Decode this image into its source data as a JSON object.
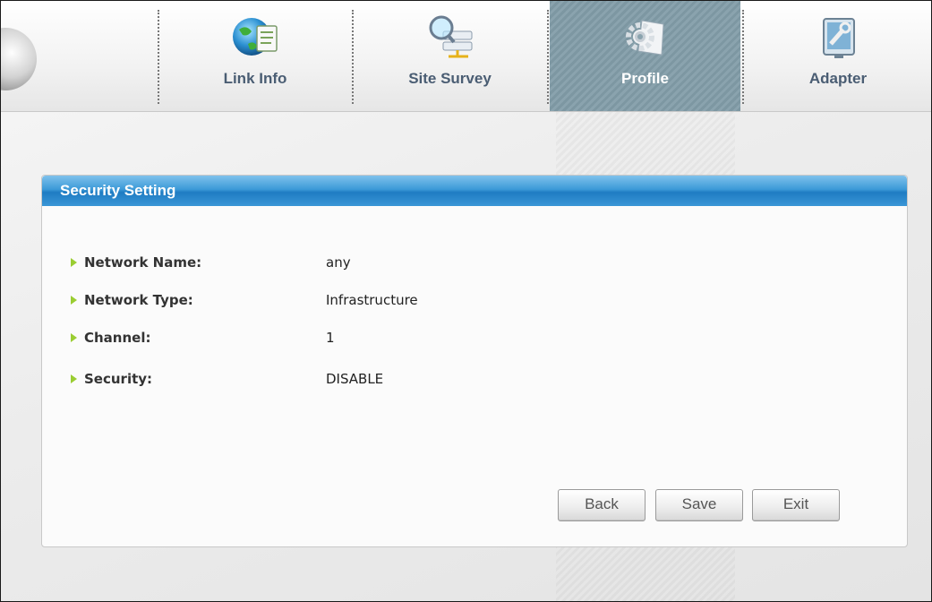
{
  "nav": {
    "tabs": [
      {
        "label": "Link Info",
        "icon": "globe-document-icon",
        "active": false
      },
      {
        "label": "Site Survey",
        "icon": "magnifier-network-icon",
        "active": false
      },
      {
        "label": "Profile",
        "icon": "gear-document-icon",
        "active": true
      },
      {
        "label": "Adapter",
        "icon": "adapter-screen-icon",
        "active": false
      }
    ]
  },
  "panel": {
    "title": "Security Setting",
    "fields": [
      {
        "label": "Network Name:",
        "value": "any"
      },
      {
        "label": "Network Type:",
        "value": "Infrastructure"
      },
      {
        "label": "Channel:",
        "value": "1"
      },
      {
        "label": "Security:",
        "value": "DISABLE"
      }
    ]
  },
  "buttons": {
    "back": "Back",
    "save": "Save",
    "exit": "Exit"
  },
  "colors": {
    "header_blue": "#2a88cc",
    "active_tab": "#8aa3ae",
    "bullet_green": "#9acd32",
    "tab_label": "#4a5d73"
  }
}
